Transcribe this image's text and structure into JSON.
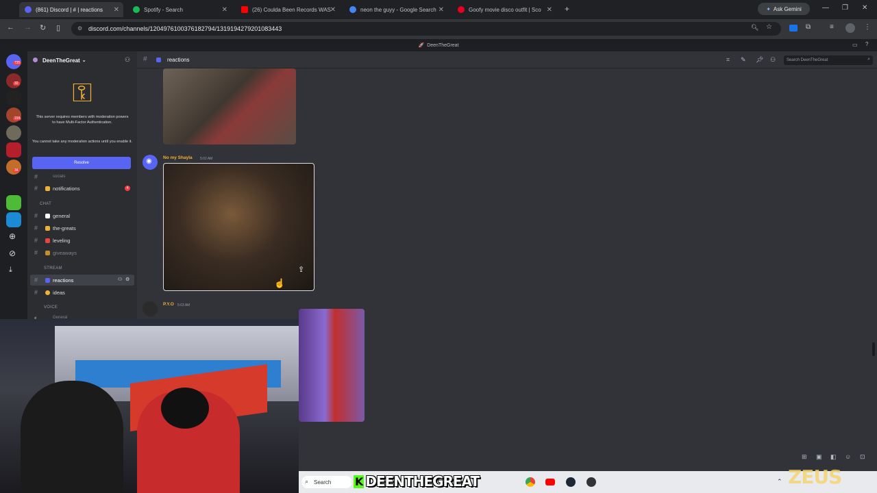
{
  "browser": {
    "tabs": [
      {
        "title": "(861) Discord | #⁩ | reactions",
        "color": "#5865f2",
        "active": true
      },
      {
        "title": "Spotify - Search",
        "color": "#1db954"
      },
      {
        "title": "(26) Coulda Been Records WAS",
        "color": "#ff0000"
      },
      {
        "title": "neon the guyy - Google Search",
        "color": "#4285f4"
      },
      {
        "title": "Goofy movie disco outfit | Sco",
        "color": "#e60023"
      }
    ],
    "ask_gemini": "Ask Gemini",
    "url": "discord.com/channels/1204976100376182794/1319194279201083443"
  },
  "discord": {
    "window_title": "DeenTheGreat",
    "server_name": "DeenTheGreat",
    "mfa_notice": "This server requires members with moderation powers to have Multi-Factor Authentication.",
    "mfa_notice2": "You cannot take any moderation actions until you enable it.",
    "resolve_label": "Resolve",
    "channels": {
      "socials": "socials",
      "notifications": "notifications",
      "notifications_badge": "4",
      "cat_chat": "CHAT",
      "general": "general",
      "the_greats": "the-greats",
      "leveling": "leveling",
      "giveaways": "giveaways",
      "cat_stream": "STREAM",
      "reactions": "reactions",
      "ideas": "ideas",
      "cat_voice": "VOICE",
      "voice_general": "General"
    },
    "header": {
      "channel": "reactions",
      "search_placeholder": "Search DeenTheGreat"
    },
    "messages": [
      {
        "author": "No my Shayla",
        "time": "5:02 AM"
      },
      {
        "author": "P.Y.O",
        "time": "5:03 AM"
      }
    ],
    "server_badges": [
      "725",
      "32",
      "154",
      "34"
    ]
  },
  "taskbar": {
    "search": "Search",
    "overlay_name": "DEENTHEGREAT",
    "overlay_prefix": "K"
  },
  "colors": {
    "blurple": "#5865f2",
    "author": "#f0b232",
    "kick_green": "#53fc18"
  }
}
